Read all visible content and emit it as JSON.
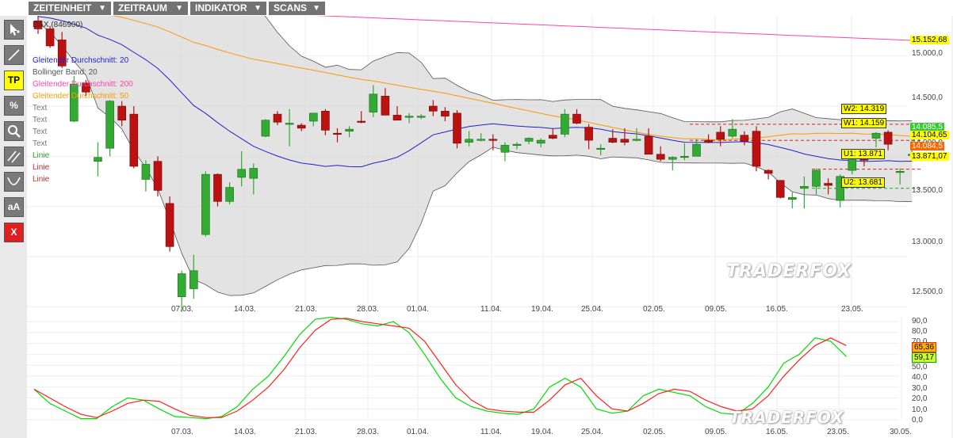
{
  "menu": {
    "items": [
      {
        "label": "ZEITEINHEIT",
        "caret": "▼"
      },
      {
        "label": "ZEITRAUM",
        "caret": "▼"
      },
      {
        "label": "INDIKATOR",
        "caret": "▼"
      },
      {
        "label": "SCANS",
        "caret": "▼"
      }
    ]
  },
  "toolbar": {
    "tools": [
      {
        "name": "cursor-tool",
        "icon": "cursor-icon"
      },
      {
        "name": "line-tool",
        "icon": "line-icon"
      },
      {
        "name": "tp-tool",
        "label": "TP"
      },
      {
        "name": "percent-tool",
        "label": "%"
      },
      {
        "name": "zoom-tool",
        "icon": "magnifier-icon"
      },
      {
        "name": "channel-tool",
        "icon": "parallel-lines-icon"
      },
      {
        "name": "arc-tool",
        "icon": "arc-icon"
      },
      {
        "name": "text-tool",
        "label": "aA"
      },
      {
        "name": "delete-tool",
        "label": "X"
      }
    ]
  },
  "legend": {
    "instrument": "DAX (846900)",
    "items": [
      {
        "label": "Gleitender Durchschnitt: 20",
        "color": "#2222cc"
      },
      {
        "label": "Bollinger Band: 20",
        "color": "#555555"
      },
      {
        "label": "Gleitender Durchschnitt: 200",
        "color": "#ff44aa"
      },
      {
        "label": "Gleitender Durchschnitt: 50",
        "color": "#ff9900"
      },
      {
        "label": "Text",
        "color": "#777777"
      },
      {
        "label": "Text",
        "color": "#777777"
      },
      {
        "label": "Text",
        "color": "#777777"
      },
      {
        "label": "Text",
        "color": "#777777"
      },
      {
        "label": "Linie",
        "color": "#22aa22"
      },
      {
        "label": "Linie",
        "color": "#dd2222"
      },
      {
        "label": "Linie",
        "color": "#dd2222"
      }
    ]
  },
  "chart_data": [
    {
      "type": "candlestick",
      "instrument": "DAX (846900)",
      "x_ticks": [
        "07.03.",
        "14.03.",
        "21.03.",
        "28.03.",
        "01.04.",
        "11.04.",
        "19.04.",
        "25.04.",
        "02.05.",
        "09.05.",
        "16.05.",
        "23.05."
      ],
      "y_ticks": [
        "15.000,0",
        "14.500,0",
        "14.000,0",
        "13.500,0",
        "13.000,0",
        "12.500,0"
      ],
      "ylim": [
        12400,
        15400
      ],
      "candles": [
        {
          "o": 15350,
          "h": 15400,
          "l": 15220,
          "c": 15270
        },
        {
          "o": 15270,
          "h": 15300,
          "l": 15080,
          "c": 15100
        },
        {
          "o": 15160,
          "h": 15240,
          "l": 14880,
          "c": 14900
        },
        {
          "o": 14350,
          "h": 14800,
          "l": 14340,
          "c": 14720
        },
        {
          "o": 14730,
          "h": 14760,
          "l": 14600,
          "c": 14640
        },
        {
          "o": 13950,
          "h": 14140,
          "l": 13800,
          "c": 13990
        },
        {
          "o": 14080,
          "h": 14560,
          "l": 14000,
          "c": 14550
        },
        {
          "o": 14500,
          "h": 14550,
          "l": 14300,
          "c": 14360
        },
        {
          "o": 14420,
          "h": 14500,
          "l": 13880,
          "c": 13900
        },
        {
          "o": 13770,
          "h": 13960,
          "l": 13650,
          "c": 13920
        },
        {
          "o": 13950,
          "h": 14000,
          "l": 13600,
          "c": 13660
        },
        {
          "o": 13530,
          "h": 13600,
          "l": 13050,
          "c": 13100
        },
        {
          "o": 12600,
          "h": 12860,
          "l": 12450,
          "c": 12830
        },
        {
          "o": 12680,
          "h": 13020,
          "l": 12580,
          "c": 12860
        },
        {
          "o": 13220,
          "h": 13850,
          "l": 13200,
          "c": 13820
        },
        {
          "o": 13820,
          "h": 13830,
          "l": 13500,
          "c": 13550
        },
        {
          "o": 13550,
          "h": 13740,
          "l": 13520,
          "c": 13690
        },
        {
          "o": 13790,
          "h": 14050,
          "l": 13700,
          "c": 13870
        },
        {
          "o": 13780,
          "h": 13930,
          "l": 13620,
          "c": 13880
        },
        {
          "o": 14200,
          "h": 14370,
          "l": 14190,
          "c": 14360
        },
        {
          "o": 14420,
          "h": 14450,
          "l": 14310,
          "c": 14340
        },
        {
          "o": 14330,
          "h": 14470,
          "l": 14100,
          "c": 14330
        },
        {
          "o": 14310,
          "h": 14330,
          "l": 14250,
          "c": 14280
        },
        {
          "o": 14350,
          "h": 14420,
          "l": 14300,
          "c": 14430
        },
        {
          "o": 14450,
          "h": 14470,
          "l": 14210,
          "c": 14260
        },
        {
          "o": 14230,
          "h": 14280,
          "l": 14140,
          "c": 14220
        },
        {
          "o": 14250,
          "h": 14300,
          "l": 14190,
          "c": 14270
        },
        {
          "o": 14350,
          "h": 14450,
          "l": 14330,
          "c": 14340
        },
        {
          "o": 14440,
          "h": 14710,
          "l": 14390,
          "c": 14620
        },
        {
          "o": 14600,
          "h": 14680,
          "l": 14410,
          "c": 14410
        },
        {
          "o": 14410,
          "h": 14500,
          "l": 14380,
          "c": 14360
        },
        {
          "o": 14390,
          "h": 14430,
          "l": 14330,
          "c": 14400
        },
        {
          "o": 14390,
          "h": 14420,
          "l": 14370,
          "c": 14400
        },
        {
          "o": 14500,
          "h": 14560,
          "l": 14400,
          "c": 14450
        },
        {
          "o": 14450,
          "h": 14490,
          "l": 14350,
          "c": 14400
        },
        {
          "o": 14430,
          "h": 14460,
          "l": 14080,
          "c": 14130
        },
        {
          "o": 14140,
          "h": 14250,
          "l": 14100,
          "c": 14170
        },
        {
          "o": 14170,
          "h": 14230,
          "l": 14150,
          "c": 14170
        },
        {
          "o": 14170,
          "h": 14220,
          "l": 14060,
          "c": 14160
        },
        {
          "o": 14040,
          "h": 14140,
          "l": 13950,
          "c": 14110
        },
        {
          "o": 14110,
          "h": 14140,
          "l": 14070,
          "c": 14120
        },
        {
          "o": 14150,
          "h": 14190,
          "l": 14120,
          "c": 14180
        },
        {
          "o": 14130,
          "h": 14180,
          "l": 14090,
          "c": 14160
        },
        {
          "o": 14210,
          "h": 14280,
          "l": 14170,
          "c": 14180
        },
        {
          "o": 14220,
          "h": 14470,
          "l": 14190,
          "c": 14420
        },
        {
          "o": 14420,
          "h": 14470,
          "l": 14320,
          "c": 14330
        },
        {
          "o": 14290,
          "h": 14320,
          "l": 14070,
          "c": 14160
        },
        {
          "o": 14070,
          "h": 14120,
          "l": 14010,
          "c": 14080
        },
        {
          "o": 14180,
          "h": 14270,
          "l": 14130,
          "c": 14140
        },
        {
          "o": 14170,
          "h": 14280,
          "l": 14110,
          "c": 14140
        },
        {
          "o": 14160,
          "h": 14280,
          "l": 14150,
          "c": 14170
        },
        {
          "o": 14200,
          "h": 14280,
          "l": 14020,
          "c": 14020
        },
        {
          "o": 14020,
          "h": 14100,
          "l": 13950,
          "c": 13970
        },
        {
          "o": 13970,
          "h": 14000,
          "l": 13860,
          "c": 13990
        },
        {
          "o": 14000,
          "h": 14130,
          "l": 13960,
          "c": 14000
        },
        {
          "o": 14000,
          "h": 14170,
          "l": 14000,
          "c": 14120
        },
        {
          "o": 14160,
          "h": 14220,
          "l": 14130,
          "c": 14140
        },
        {
          "o": 14240,
          "h": 14300,
          "l": 14100,
          "c": 14170
        },
        {
          "o": 14200,
          "h": 14370,
          "l": 14180,
          "c": 14270
        },
        {
          "o": 14210,
          "h": 14250,
          "l": 14110,
          "c": 14150
        },
        {
          "o": 14250,
          "h": 14300,
          "l": 13850,
          "c": 13900
        },
        {
          "o": 13860,
          "h": 13870,
          "l": 13770,
          "c": 13830
        },
        {
          "o": 13760,
          "h": 13760,
          "l": 13580,
          "c": 13590
        },
        {
          "o": 13570,
          "h": 13640,
          "l": 13480,
          "c": 13590
        },
        {
          "o": 13680,
          "h": 13800,
          "l": 13480,
          "c": 13700
        },
        {
          "o": 13700,
          "h": 13880,
          "l": 13620,
          "c": 13860
        },
        {
          "o": 13730,
          "h": 13780,
          "l": 13620,
          "c": 13710
        },
        {
          "o": 13560,
          "h": 13820,
          "l": 13490,
          "c": 13800
        },
        {
          "o": 13860,
          "h": 14040,
          "l": 13820,
          "c": 14020
        },
        {
          "o": 14020,
          "h": 14070,
          "l": 13900,
          "c": 13960
        },
        {
          "o": 14180,
          "h": 14240,
          "l": 14090,
          "c": 14230
        },
        {
          "o": 14240,
          "h": 14260,
          "l": 14060,
          "c": 14120
        },
        {
          "o": 13850,
          "h": 13880,
          "l": 13720,
          "c": 13850
        },
        {
          "o": 14020,
          "h": 14250,
          "l": 14010,
          "c": 14020
        }
      ],
      "overlays": {
        "sma20": {
          "color": "#2222cc"
        },
        "sma50": {
          "color": "#ff9900"
        },
        "sma200": {
          "color": "#ff44aa"
        },
        "bollinger20": {
          "color": "#555555"
        }
      },
      "horizontal_lines": [
        {
          "label": "W2: 14.319",
          "value": 14319,
          "color": "#dd2222"
        },
        {
          "label": "W1: 14.159",
          "value": 14159,
          "color": "#dd2222"
        },
        {
          "label": "U1: 13.871",
          "value": 13871,
          "color": "#dd2222"
        },
        {
          "label": "U2: 13.681",
          "value": 13681,
          "color": "#22aa22"
        }
      ],
      "price_tags": [
        {
          "label": "15.152,68",
          "value": 15152.68,
          "bg": "#ffff00",
          "fg": "#000000"
        },
        {
          "label": "14.085,5",
          "value": 14085.5,
          "bg": "#33cc33",
          "fg": "#ffffff"
        },
        {
          "label": "14.104,65",
          "value": 14104.65,
          "bg": "#ffff00",
          "fg": "#000000"
        },
        {
          "label": "14.084,5",
          "value": 14084.5,
          "bg": "#ff6600",
          "fg": "#ffffff"
        },
        {
          "label": "13.871,07",
          "value": 13871.07,
          "bg": "#ffff00",
          "fg": "#000000"
        }
      ]
    },
    {
      "type": "line",
      "x_ticks": [
        "07.03.",
        "14.03.",
        "21.03.",
        "28.03.",
        "01.04.",
        "11.04.",
        "19.04.",
        "25.04.",
        "02.05.",
        "09.05.",
        "16.05.",
        "23.05.",
        "30.05."
      ],
      "y_ticks": [
        "90,0",
        "80,0",
        "70,0",
        "60,0",
        "50,0",
        "40,0",
        "30,0",
        "20,0",
        "10,0",
        "0,0"
      ],
      "ylim": [
        0,
        90
      ],
      "series": [
        {
          "color": "#00dd00",
          "values": [
            28,
            15,
            8,
            1,
            1,
            12,
            20,
            18,
            10,
            3,
            2,
            1,
            3,
            12,
            28,
            40,
            58,
            78,
            92,
            94,
            92,
            88,
            86,
            90,
            80,
            60,
            38,
            20,
            12,
            8,
            6,
            5,
            10,
            30,
            38,
            30,
            10,
            6,
            8,
            22,
            28,
            25,
            22,
            12,
            6,
            5,
            15,
            30,
            52,
            60,
            75,
            72,
            58
          ]
        },
        {
          "color": "#ff2020",
          "values": [
            28,
            20,
            12,
            5,
            2,
            8,
            15,
            18,
            17,
            10,
            4,
            2,
            2,
            8,
            18,
            30,
            46,
            66,
            82,
            92,
            93,
            90,
            88,
            86,
            84,
            72,
            52,
            32,
            18,
            10,
            8,
            7,
            7,
            18,
            32,
            38,
            22,
            10,
            8,
            15,
            24,
            28,
            26,
            18,
            12,
            8,
            10,
            22,
            40,
            55,
            68,
            75,
            68
          ]
        }
      ],
      "value_tags": [
        {
          "label": "65,36",
          "value": 65.36,
          "bg": "#ffb000",
          "fg": "#000000",
          "border": "#ff2020"
        },
        {
          "label": "59,17",
          "value": 59.17,
          "bg": "#ccff33",
          "fg": "#000000",
          "border": "#00aa00"
        }
      ]
    }
  ],
  "watermark": {
    "text": "TRADERFOX"
  }
}
